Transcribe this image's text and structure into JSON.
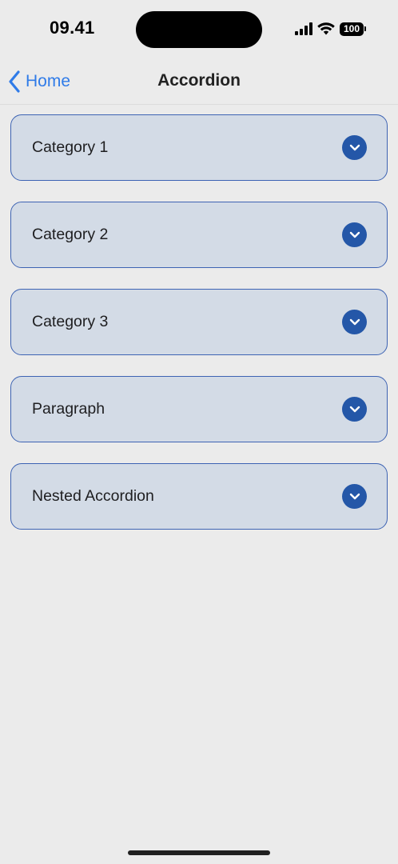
{
  "status_bar": {
    "time": "09.41",
    "battery_level": "100",
    "icons": [
      "signal-icon",
      "wifi-icon",
      "battery-icon"
    ]
  },
  "nav": {
    "back_label": "Home",
    "title": "Accordion"
  },
  "accordion": {
    "items": [
      {
        "label": "Category 1",
        "expanded": false
      },
      {
        "label": "Category 2",
        "expanded": false
      },
      {
        "label": "Category 3",
        "expanded": false
      },
      {
        "label": "Paragraph",
        "expanded": false
      },
      {
        "label": "Nested Accordion",
        "expanded": false
      }
    ]
  },
  "colors": {
    "background": "#ebebeb",
    "accent": "#2f7be8",
    "item_fill": "#d3dbe6",
    "item_border": "#3d63b3",
    "chevron_fill": "#2457a8"
  }
}
